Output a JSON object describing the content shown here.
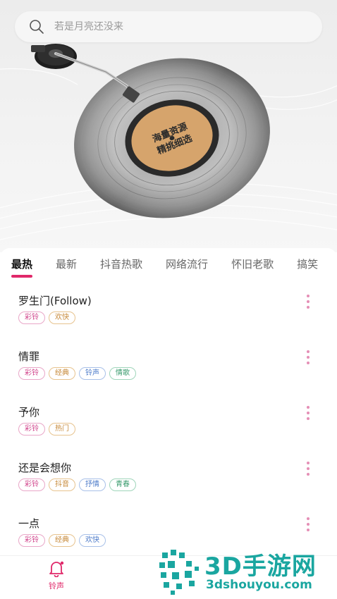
{
  "search": {
    "placeholder": "若是月亮还没来"
  },
  "record": {
    "label_line1": "海量资源",
    "label_line2": "精挑细选"
  },
  "tabs": [
    {
      "label": "最热",
      "active": true
    },
    {
      "label": "最新"
    },
    {
      "label": "抖音热歌"
    },
    {
      "label": "网络流行"
    },
    {
      "label": "怀旧老歌"
    },
    {
      "label": "搞笑"
    }
  ],
  "songs": [
    {
      "title": "罗生门(Follow)",
      "tags": [
        {
          "label": "彩铃",
          "color": "pink"
        },
        {
          "label": "欢快",
          "color": "orange"
        }
      ]
    },
    {
      "title": "情罪",
      "tags": [
        {
          "label": "彩铃",
          "color": "pink"
        },
        {
          "label": "经典",
          "color": "orange"
        },
        {
          "label": "铃声",
          "color": "blue"
        },
        {
          "label": "情歌",
          "color": "green"
        }
      ]
    },
    {
      "title": "予你",
      "tags": [
        {
          "label": "彩铃",
          "color": "pink"
        },
        {
          "label": "热门",
          "color": "orange"
        }
      ]
    },
    {
      "title": "还是会想你",
      "tags": [
        {
          "label": "彩铃",
          "color": "pink"
        },
        {
          "label": "抖音",
          "color": "orange"
        },
        {
          "label": "抒情",
          "color": "blue"
        },
        {
          "label": "青春",
          "color": "green"
        }
      ]
    },
    {
      "title": "一点",
      "tags": [
        {
          "label": "彩铃",
          "color": "pink"
        },
        {
          "label": "经典",
          "color": "orange"
        },
        {
          "label": "欢快",
          "color": "blue"
        }
      ]
    }
  ],
  "bottom_nav": {
    "ringtone_label": "铃声"
  },
  "watermark": {
    "brand": "3D手游网",
    "url": "3dshouyou.com"
  },
  "colors": {
    "accent": "#e0286a",
    "watermark": "#1aa6a0"
  }
}
